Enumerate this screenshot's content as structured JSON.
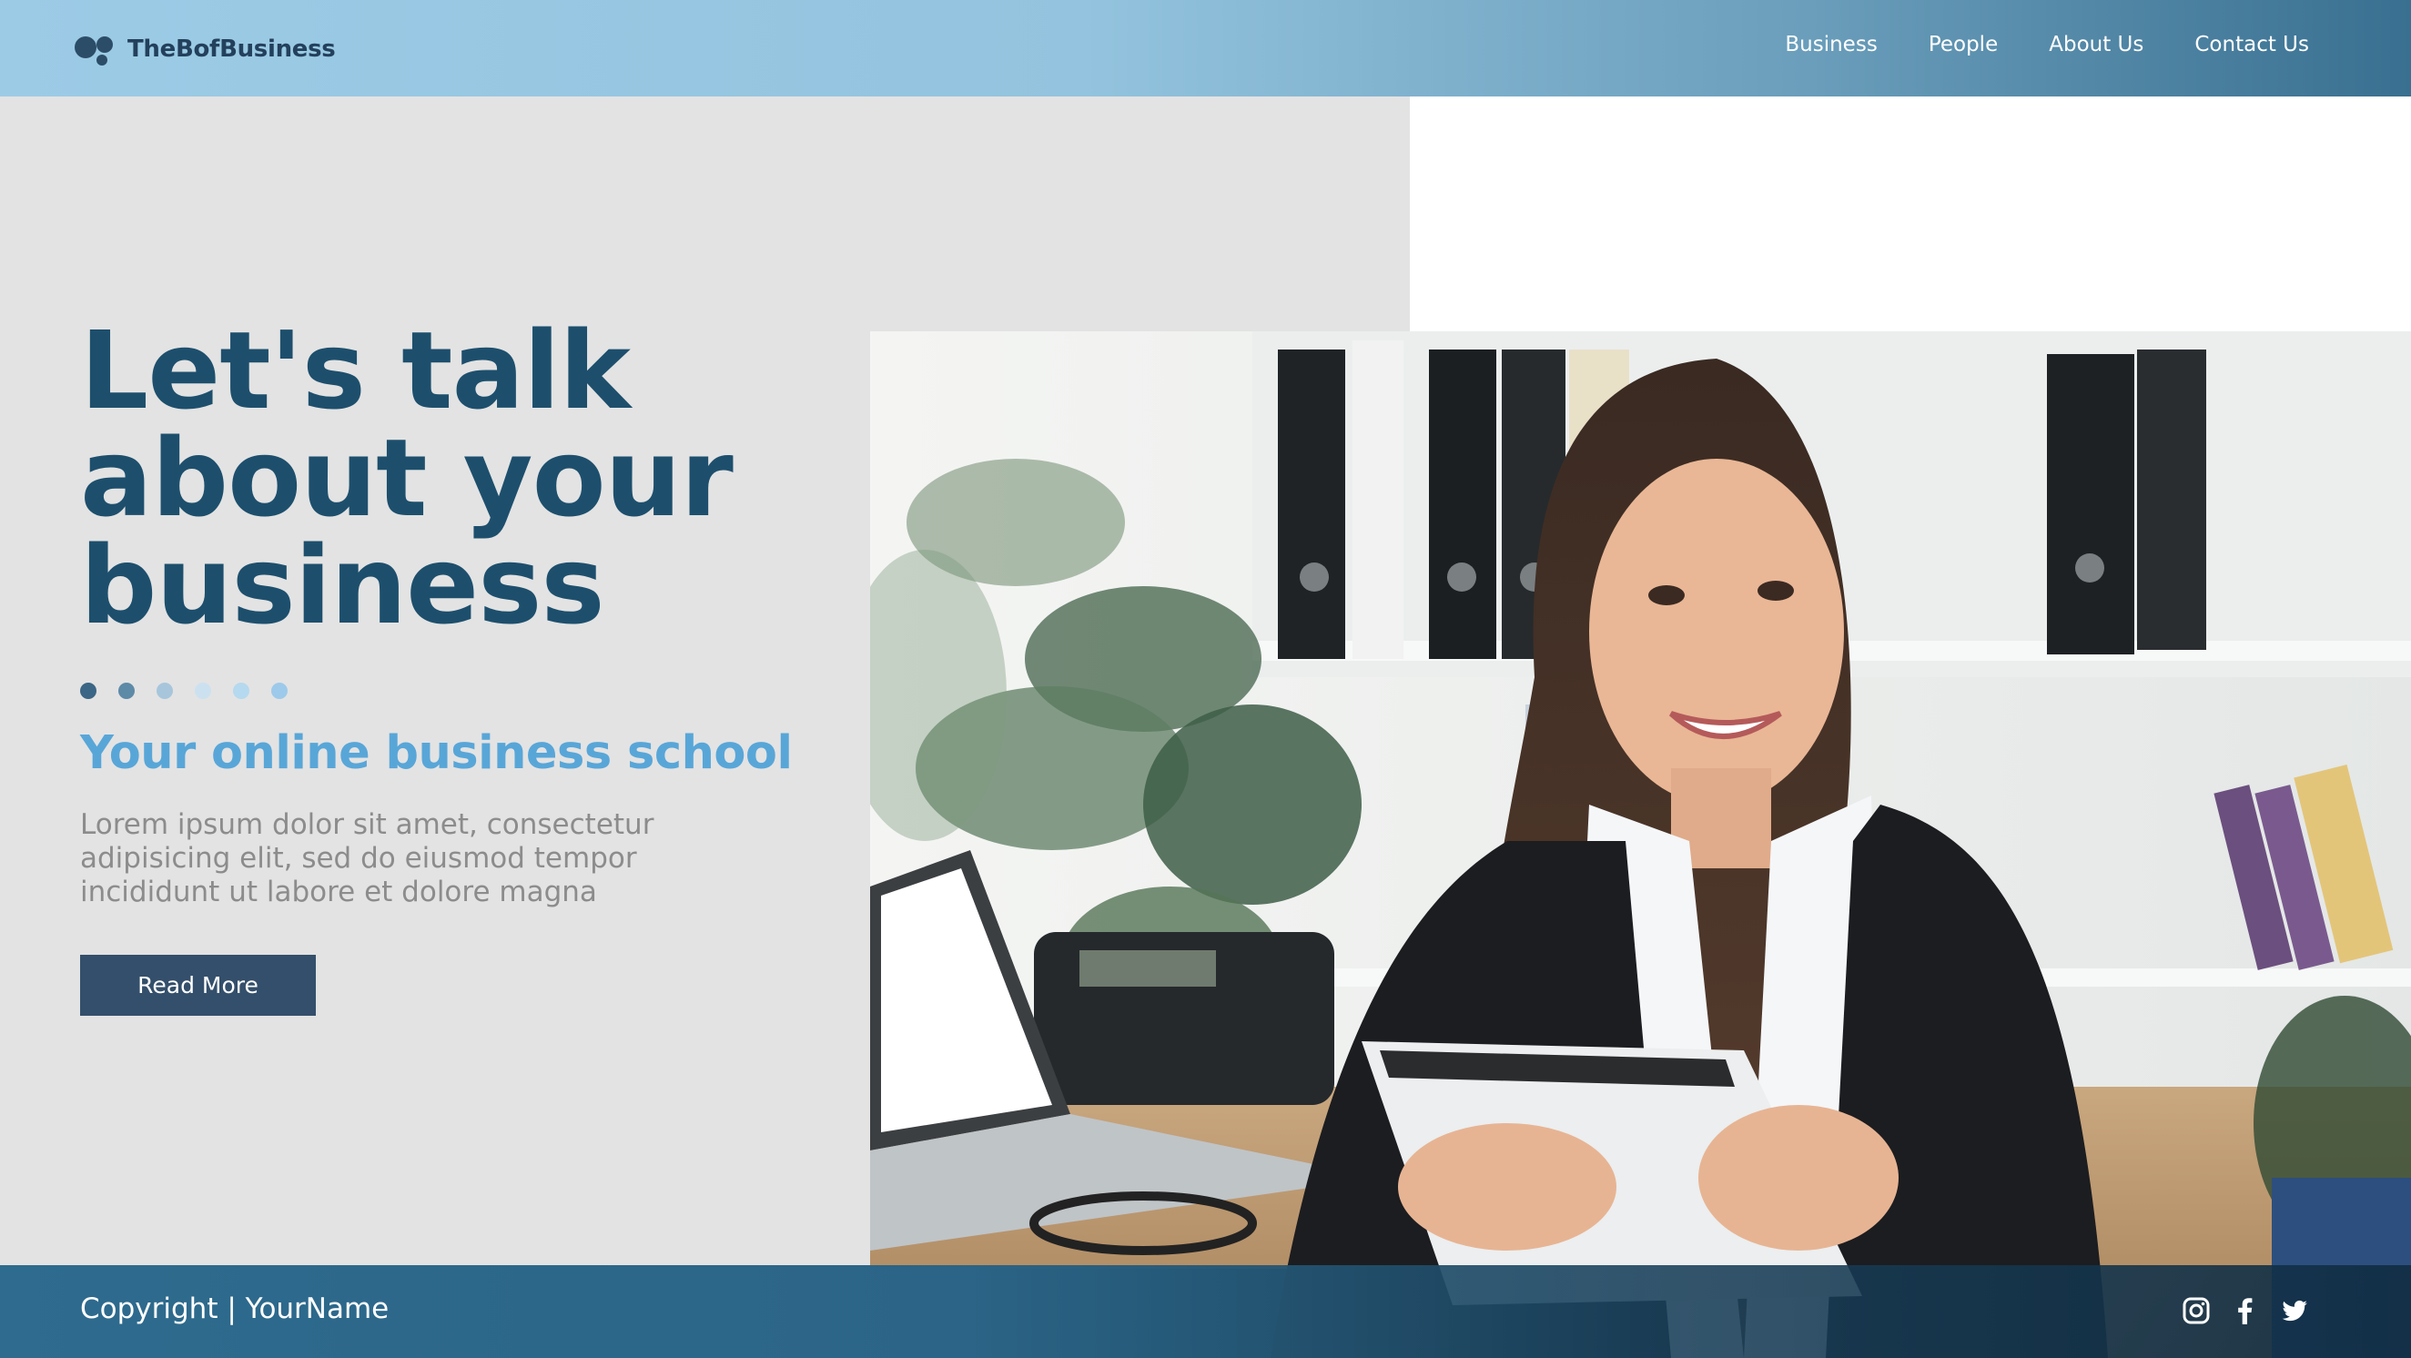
{
  "brand": {
    "name": "TheBofBusiness"
  },
  "nav": {
    "items": [
      {
        "label": "Business"
      },
      {
        "label": "People"
      },
      {
        "label": "About Us"
      },
      {
        "label": "Contact Us"
      }
    ]
  },
  "hero": {
    "title": "Let's talk about your business",
    "subtitle": "Your online business school",
    "description": "Lorem ipsum dolor sit amet, consectetur adipisicing elit, sed do eiusmod tempor incididunt ut labore et dolore magna",
    "cta_label": "Read More",
    "image": "office-woman-with-tablet-photo"
  },
  "footer": {
    "copyright": "Copyright | YourName",
    "social_icons": [
      "instagram-icon",
      "facebook-icon",
      "twitter-icon"
    ]
  },
  "colors": {
    "header_start": "#9ccbe6",
    "header_end": "#396f90",
    "title": "#1d4f6d",
    "subtitle": "#58a6d8",
    "button": "#344f6b",
    "footer": "#2e6b8e",
    "background": "#e3e3e3"
  }
}
